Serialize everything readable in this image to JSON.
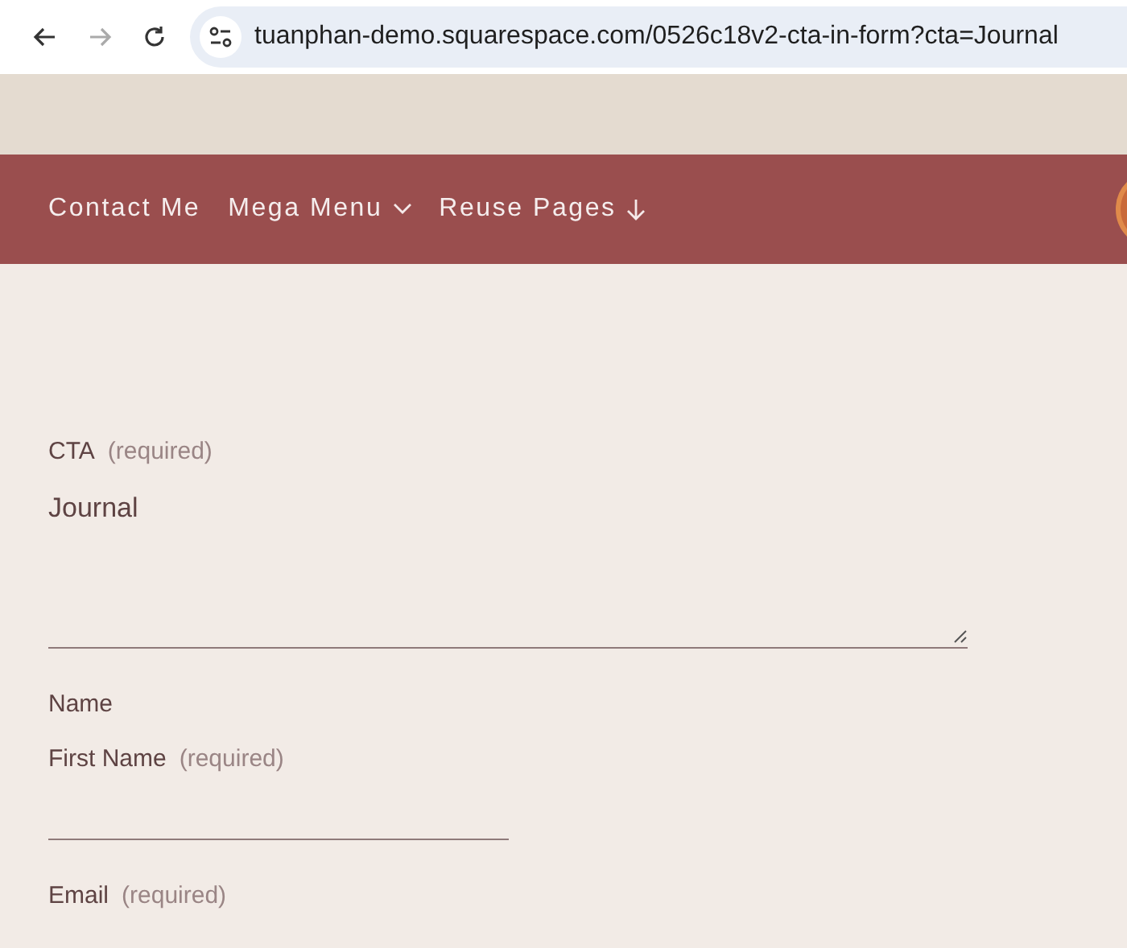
{
  "browser": {
    "url": "tuanphan-demo.squarespace.com/0526c18v2-cta-in-form?cta=Journal",
    "back_enabled": true,
    "forward_enabled": false
  },
  "nav": [
    {
      "label": "Contact Me",
      "kind": "link"
    },
    {
      "label": "Mega Menu",
      "kind": "dropdown"
    },
    {
      "label": "Reuse Pages",
      "kind": "anchor"
    }
  ],
  "form": [
    {
      "kind": "textarea",
      "label": "CTA",
      "required_note": "(required)",
      "value": "Journal"
    },
    {
      "kind": "group",
      "label": "Name"
    },
    {
      "kind": "text",
      "label": "First Name",
      "required_note": "(required)"
    },
    {
      "kind": "label",
      "label": "Email",
      "required_note": "(required)"
    }
  ]
}
